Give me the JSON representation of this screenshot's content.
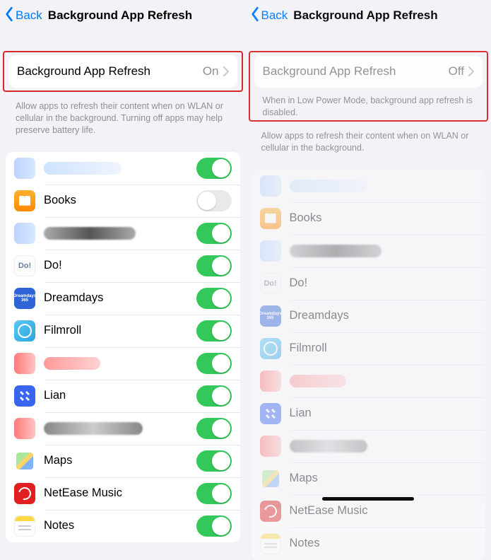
{
  "nav": {
    "back": "Back",
    "title": "Background App Refresh"
  },
  "master": {
    "label": "Background App Refresh",
    "value_on": "On",
    "value_off": "Off"
  },
  "lpm_note": "When in Low Power Mode, background app refresh is disabled.",
  "desc_long": "Allow apps to refresh their content when on WLAN or cellular in the background. Turning off apps may help preserve battery life.",
  "desc_short": "Allow apps to refresh their content when on WLAN or cellular in the background.",
  "apps": {
    "books": "Books",
    "do": "Do!",
    "dreamdays": "Dreamdays",
    "filmroll": "Filmroll",
    "lian": "Lian",
    "maps": "Maps",
    "netease": "NetEase Music",
    "notes": "Notes"
  },
  "icon_text": {
    "do": "Do!",
    "dream": "Dreamdays\n365"
  }
}
